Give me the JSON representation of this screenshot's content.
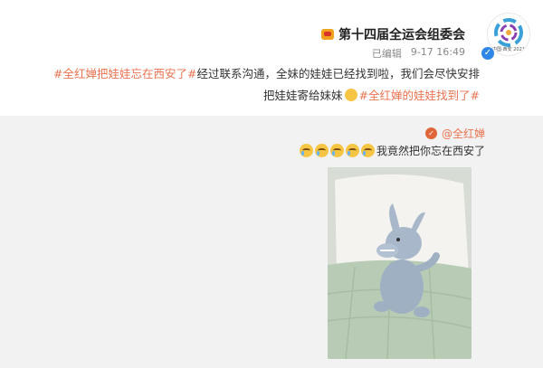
{
  "post": {
    "author": "第十四届全运会组委会",
    "avatar_caption": "中国·西安 2021",
    "time": "9-17 16:49",
    "edited": "已编辑",
    "body_line1_hashtag": "#全红婵把娃娃忘在西安了#",
    "body_line1_text": "经过联系沟通，全妹的娃娃已经找到啦，我们会尽快安排",
    "body_line2_text": "把娃娃寄给妹妹",
    "body_line2_hashtag": "#全红婵的娃娃找到了#"
  },
  "repost": {
    "author": "@全红婵",
    "text": "我竟然把你忘在西安了",
    "emoji_count": 5
  },
  "icons": {
    "avatar": "games-logo-icon",
    "verified": "verified-badge-icon",
    "crown": "crown-icon",
    "cry": "crying-emoji-icon"
  },
  "colors": {
    "hashtag": "#eb7350",
    "repost_bg": "#f2f2f2",
    "verified": "#2e87e6"
  }
}
